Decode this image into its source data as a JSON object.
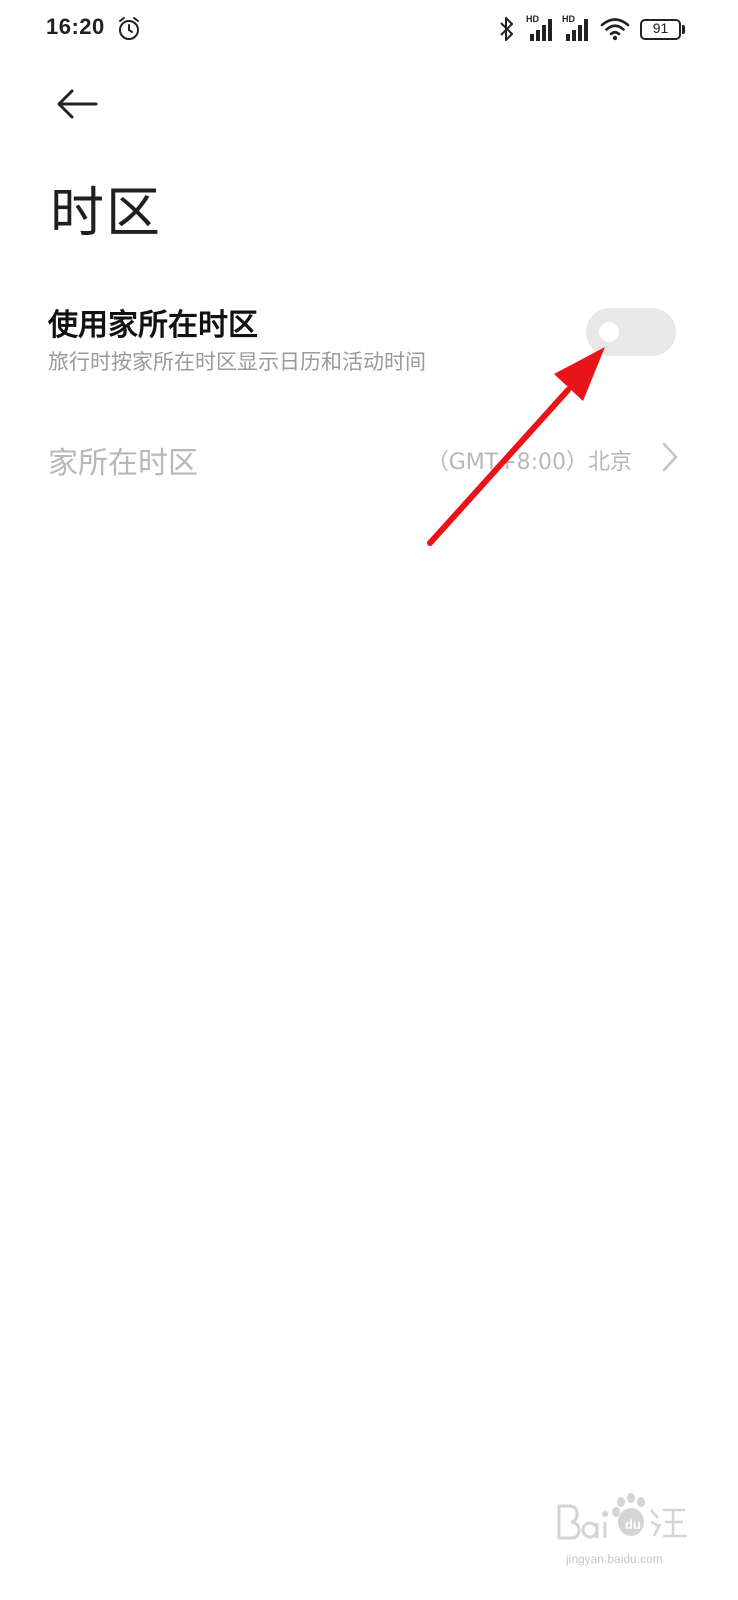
{
  "status_bar": {
    "time": "16:20",
    "alarm_icon": "alarm-clock-icon",
    "bluetooth_icon": "bluetooth-icon",
    "signal_1_label": "HD",
    "signal_2_label": "HD",
    "wifi_icon": "wifi-icon",
    "battery_level": "91"
  },
  "header": {
    "back_icon": "arrow-left-icon",
    "title": "时区"
  },
  "settings": {
    "home_timezone": {
      "title": "使用家所在时区",
      "summary": "旅行时按家所在时区显示日历和活动时间",
      "enabled": false
    },
    "home_zone": {
      "label": "家所在时区",
      "value": "（GMT+8:00）北京",
      "icon": "chevron-right-icon"
    }
  },
  "annotation": {
    "color": "#e8141a"
  },
  "watermark": {
    "url": "jingyan.baidu.com"
  },
  "colors": {
    "background": "#ffffff",
    "title_text": "#111111",
    "secondary_text": "#9a9a9a",
    "disabled_text": "#b8b8b8",
    "toggle_off": "#e8e8e8"
  }
}
